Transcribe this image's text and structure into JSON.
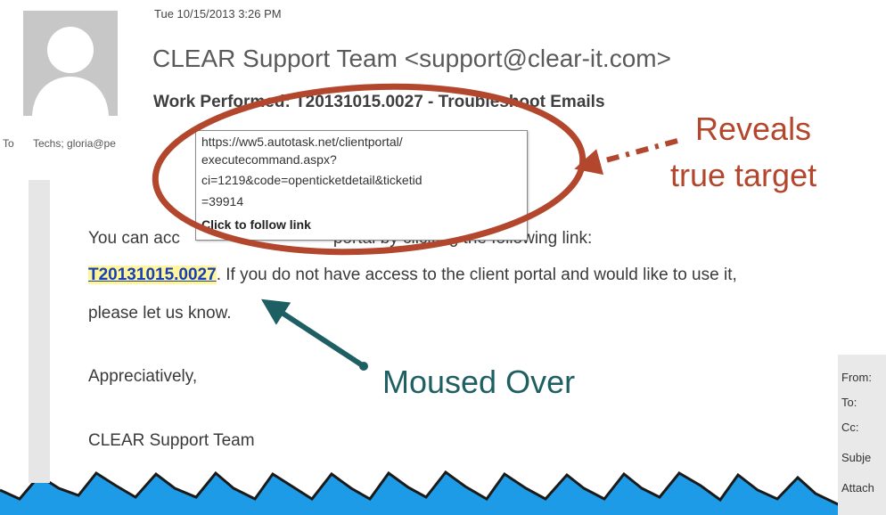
{
  "email": {
    "date": "Tue 10/15/2013 3:26 PM",
    "sender": "CLEAR Support Team <support@clear-it.com>",
    "subject": "Work Performed: T20131015.0027 - Troubleshoot Emails",
    "to_label": "To",
    "to_value": "Techs; gloria@pe",
    "body": {
      "line1_prefix": "You can acc",
      "line1_suffix": "portal by clicking the following link:",
      "link_text": "T20131015.0027",
      "line2_rest": ". If you do not have access to the client portal and would like to use it,",
      "line3": "please let us know.",
      "closing": "Appreciatively,",
      "signature": "CLEAR Support Team"
    }
  },
  "tooltip": {
    "url_lines": [
      "https://ww5.autotask.net/clientportal/",
      "executecommand.aspx?",
      "ci=1219&code=openticketdetail&ticketid",
      "=39914"
    ],
    "follow_hint": "Click to follow link"
  },
  "preview_pane": {
    "labels": [
      "From:",
      "To:",
      "Cc:",
      "Subje",
      "Attach"
    ]
  },
  "annotations": {
    "reveals_line1": "Reveals",
    "reveals_line2": "true target",
    "moused_over": "Moused Over",
    "ellipse_color": "#b3472d",
    "arrow_color": "#1e5f63"
  },
  "colors": {
    "background": "#1e9be6",
    "link": "#1a3fb0",
    "highlight": "#fff59a"
  }
}
